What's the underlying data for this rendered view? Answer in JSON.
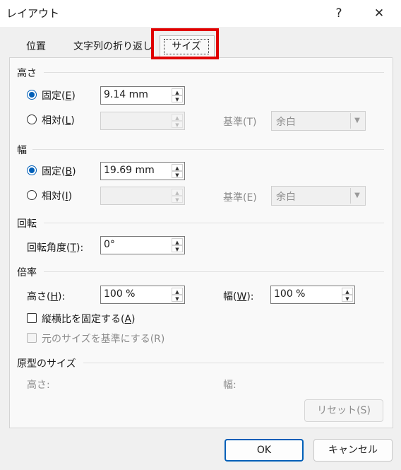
{
  "window": {
    "title": "レイアウト",
    "help_label": "?",
    "close_label": "✕"
  },
  "tabs": [
    {
      "label": "位置",
      "active": false
    },
    {
      "label": "文字列の折り返し",
      "active": false
    },
    {
      "label": "サイズ",
      "active": true
    }
  ],
  "height": {
    "section_label": "高さ",
    "absolute": {
      "label": "固定(",
      "key": "E",
      "suffix": ")",
      "value": "9.14 mm",
      "selected": true
    },
    "relative": {
      "label": "相対(",
      "key": "L",
      "suffix": ")",
      "value": "",
      "selected": false
    },
    "relative_to_label": "基準(T)",
    "relative_to_value": "余白"
  },
  "width": {
    "section_label": "幅",
    "absolute": {
      "label": "固定(",
      "key": "B",
      "suffix": ")",
      "value": "19.69 mm",
      "selected": true
    },
    "relative": {
      "label": "相対(",
      "key": "I",
      "suffix": ")",
      "value": "",
      "selected": false
    },
    "relative_to_label": "基準(E)",
    "relative_to_value": "余白"
  },
  "rotate": {
    "section_label": "回転",
    "rotation_label": "回転角度(",
    "rotation_key": "T",
    "rotation_suffix": "):",
    "rotation_value": "0°"
  },
  "scale": {
    "section_label": "倍率",
    "height_label": "高さ(",
    "height_key": "H",
    "height_suffix": "):",
    "height_value": "100 %",
    "width_label": "幅(",
    "width_key": "W",
    "width_suffix": "):",
    "width_value": "100 %",
    "lock_aspect_label": "縦横比を固定する(",
    "lock_aspect_key": "A",
    "lock_aspect_suffix": ")",
    "lock_aspect_checked": false,
    "relative_original_label": "元のサイズを基準にする(R)",
    "relative_original_checked": false
  },
  "original": {
    "section_label": "原型のサイズ",
    "height_label": "高さ:",
    "width_label": "幅:"
  },
  "buttons": {
    "reset": "リセット(S)",
    "ok": "OK",
    "cancel": "キャンセル"
  },
  "colors": {
    "accent": "#005fb8",
    "highlight": "#e00000"
  }
}
